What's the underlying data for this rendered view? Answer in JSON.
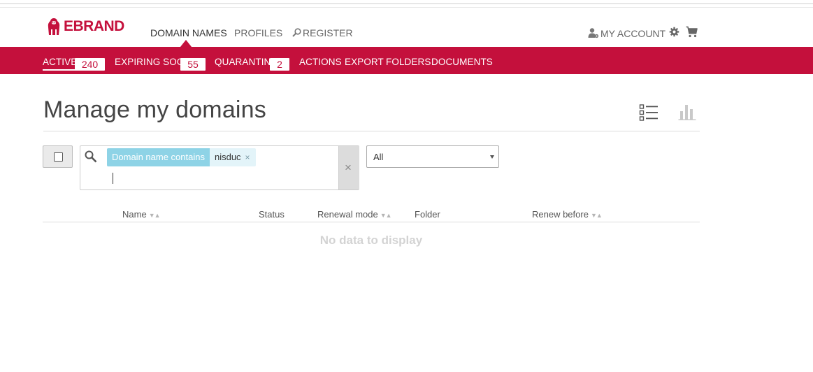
{
  "brand": {
    "name": "EBRAND",
    "color": "#c4103c"
  },
  "nav": {
    "items": [
      {
        "label": "DOMAIN NAMES",
        "active": true
      },
      {
        "label": "PROFILES",
        "active": false
      },
      {
        "label": "REGISTER",
        "active": false,
        "icon": "search-icon"
      }
    ],
    "account_label": "MY ACCOUNT",
    "account_icon": "user-gear-icon",
    "settings_icon": "gear-icon",
    "cart_icon": "cart-icon"
  },
  "subnav": {
    "items": [
      {
        "label": "ACTIVE",
        "count": "240",
        "active": true
      },
      {
        "label": "EXPIRING SOON",
        "count": "55",
        "active": false
      },
      {
        "label": "QUARANTINE",
        "count": "2",
        "active": false
      },
      {
        "label": "ACTIONS"
      },
      {
        "label": "EXPORT"
      },
      {
        "label": "FOLDERS"
      },
      {
        "label": "DOCUMENTS"
      }
    ]
  },
  "page": {
    "title": "Manage my domains",
    "view_icons": [
      "list-view-icon",
      "chart-view-icon"
    ]
  },
  "filters": {
    "chip_label": "Domain name contains",
    "chip_value": "nisduc",
    "chip_remove": "×",
    "clear": "×",
    "select_value": "All"
  },
  "table": {
    "columns": [
      {
        "label": "Name",
        "sortable": true
      },
      {
        "label": "Status",
        "sortable": false
      },
      {
        "label": "Renewal mode",
        "sortable": true
      },
      {
        "label": "Folder",
        "sortable": false
      },
      {
        "label": "Renew before",
        "sortable": true
      }
    ],
    "sort_glyph": "▼▲",
    "empty_message": "No data to display"
  }
}
